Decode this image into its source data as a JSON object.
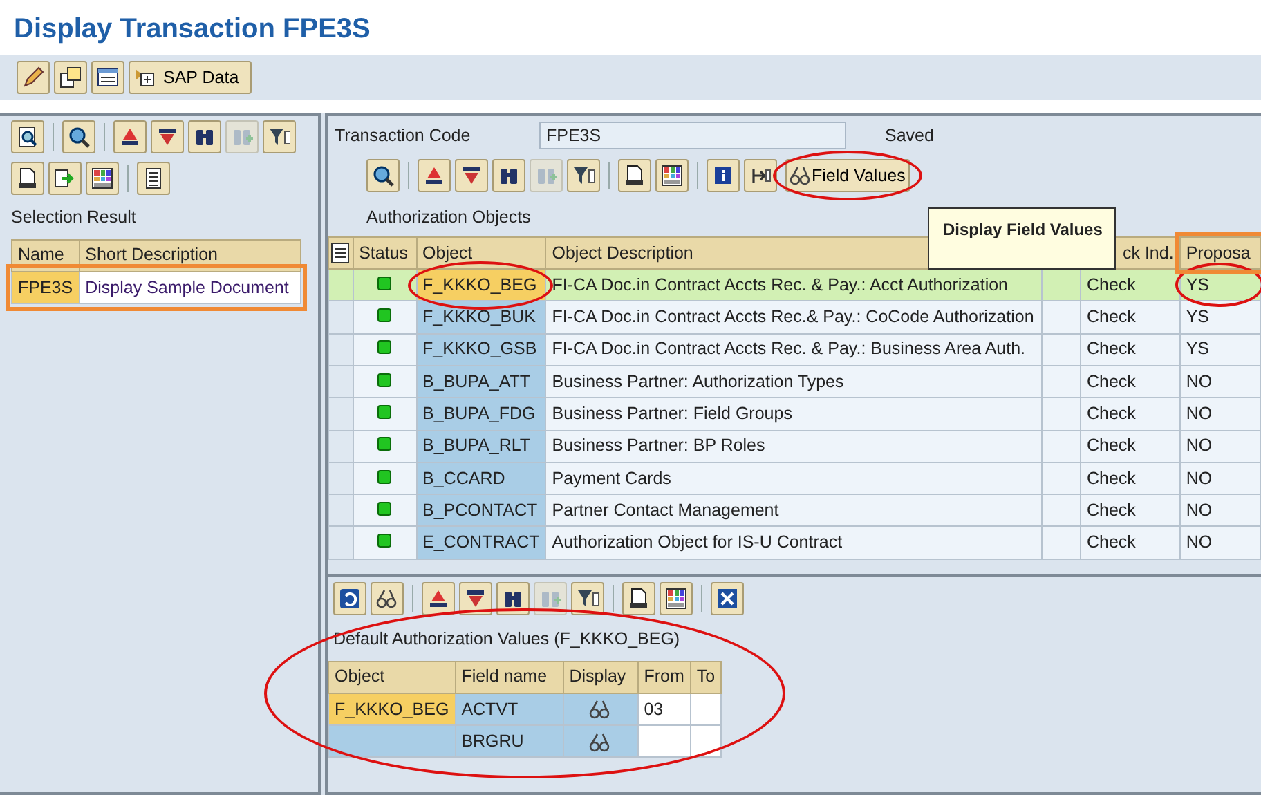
{
  "title": "Display Transaction FPE3S",
  "app_toolbar": {
    "buttons": [
      {
        "disabled": false
      },
      {
        "disabled": false
      },
      {
        "disabled": false
      },
      {
        "disabled": false,
        "label": "SAP Data"
      }
    ]
  },
  "left_panel": {
    "toolbar": [
      {
        "disabled": false
      },
      {
        "disabled": false
      },
      {
        "disabled": false
      },
      {
        "disabled": false
      },
      {
        "disabled": false
      },
      {
        "disabled": true
      },
      {
        "disabled": false
      }
    ],
    "toolbar_2": [
      {
        "disabled": false
      },
      {
        "disabled": false
      },
      {
        "disabled": false
      },
      {
        "disabled": false
      }
    ],
    "heading": "Selection Result",
    "columns": [
      "Name",
      "Short Description"
    ],
    "rows": [
      {
        "name": "FPE3S",
        "description": "Display Sample Document",
        "selected": true
      }
    ]
  },
  "transaction": {
    "label": "Transaction Code",
    "value": "FPE3S",
    "status": "Saved"
  },
  "auth_toolbar": {
    "buttons": [
      {
        "disabled": false
      },
      {
        "disabled": false
      },
      {
        "disabled": false
      },
      {
        "disabled": false
      },
      {
        "disabled": true
      },
      {
        "disabled": false
      },
      {
        "disabled": false
      },
      {
        "disabled": false
      },
      {
        "disabled": false
      },
      {
        "disabled": false
      }
    ],
    "field_values": "Field Values"
  },
  "tooltip": "Display Field Values",
  "auth_objects": {
    "title": "Authorization Objects",
    "columns": [
      {
        "label": "Status"
      },
      {
        "label": "Object"
      },
      {
        "label": "Object Description"
      },
      {},
      {
        "label": "ck Ind."
      },
      {
        "label": "Proposa"
      }
    ],
    "rows": [
      {
        "object": "F_KKKO_BEG",
        "description": "FI-CA Doc.in Contract Accts Rec. & Pay.: Acct Authorization",
        "check": "Check",
        "proposal": "YS",
        "selected": true
      },
      {
        "object": "F_KKKO_BUK",
        "description": "FI-CA Doc.in Contract Accts Rec.& Pay.: CoCode Authorization",
        "check": "Check",
        "proposal": "YS",
        "selected": false
      },
      {
        "object": "F_KKKO_GSB",
        "description": "FI-CA Doc.in Contract Accts Rec. & Pay.: Business Area Auth.",
        "check": "Check",
        "proposal": "YS",
        "selected": false
      },
      {
        "object": "B_BUPA_ATT",
        "description": "Business Partner: Authorization Types",
        "check": "Check",
        "proposal": "NO",
        "selected": false
      },
      {
        "object": "B_BUPA_FDG",
        "description": "Business Partner: Field Groups",
        "check": "Check",
        "proposal": "NO",
        "selected": false
      },
      {
        "object": "B_BUPA_RLT",
        "description": "Business Partner: BP Roles",
        "check": "Check",
        "proposal": "NO",
        "selected": false
      },
      {
        "object": "B_CCARD",
        "description": "Payment Cards",
        "check": "Check",
        "proposal": "NO",
        "selected": false
      },
      {
        "object": "B_PCONTACT",
        "description": "Partner Contact Management",
        "check": "Check",
        "proposal": "NO",
        "selected": false
      },
      {
        "object": "E_CONTRACT",
        "description": "Authorization Object for IS-U Contract",
        "check": "Check",
        "proposal": "NO",
        "selected": false
      }
    ]
  },
  "default_values": {
    "toolbar": [
      {
        "disabled": false
      },
      {
        "disabled": false
      },
      {
        "disabled": false
      },
      {
        "disabled": false
      },
      {
        "disabled": false
      },
      {
        "disabled": true
      },
      {
        "disabled": false
      },
      {
        "disabled": false
      },
      {
        "disabled": false
      },
      {
        "disabled": false
      }
    ],
    "title": "Default Authorization Values (F_KKKO_BEG)",
    "columns": [
      "Object",
      "Field name",
      "Display",
      "From",
      "To"
    ],
    "rows": [
      {
        "object": "F_KKKO_BEG",
        "field": "ACTVT",
        "from": "03"
      },
      {
        "field": "BRGRU"
      }
    ]
  }
}
